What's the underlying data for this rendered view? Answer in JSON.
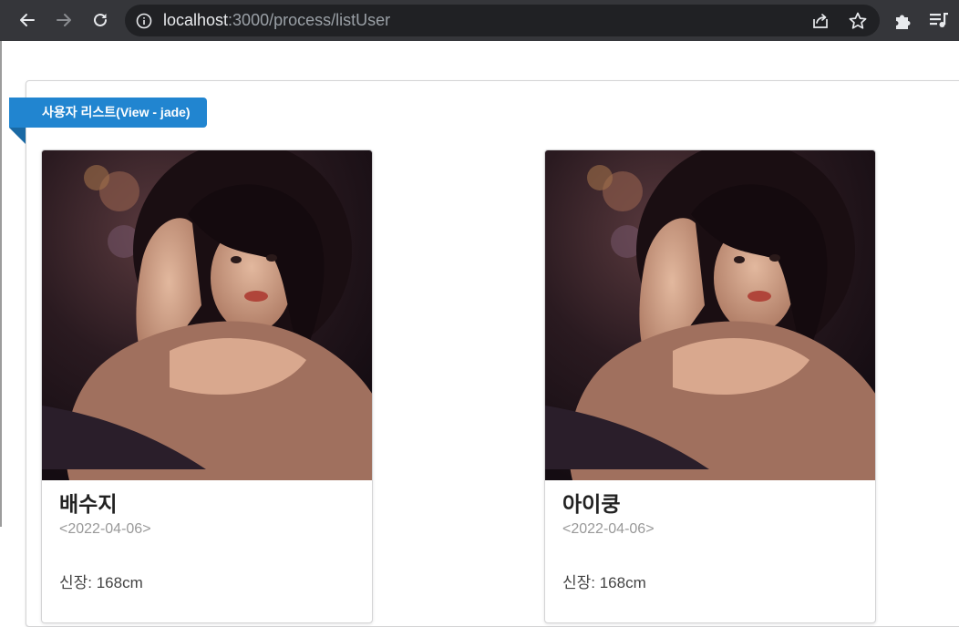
{
  "browser": {
    "url_host": "localhost",
    "url_path": ":3000/process/listUser"
  },
  "page": {
    "ribbon_label": "사용자 리스트(View - jade)"
  },
  "users": [
    {
      "name": "배수지",
      "date": "<2022-04-06>",
      "height": "신장: 168cm"
    },
    {
      "name": "아이쿵",
      "date": "<2022-04-06>",
      "height": "신장: 168cm"
    }
  ],
  "colors": {
    "ribbon": "#2185d0",
    "chrome": "#35363a",
    "omnibox": "#202124"
  }
}
